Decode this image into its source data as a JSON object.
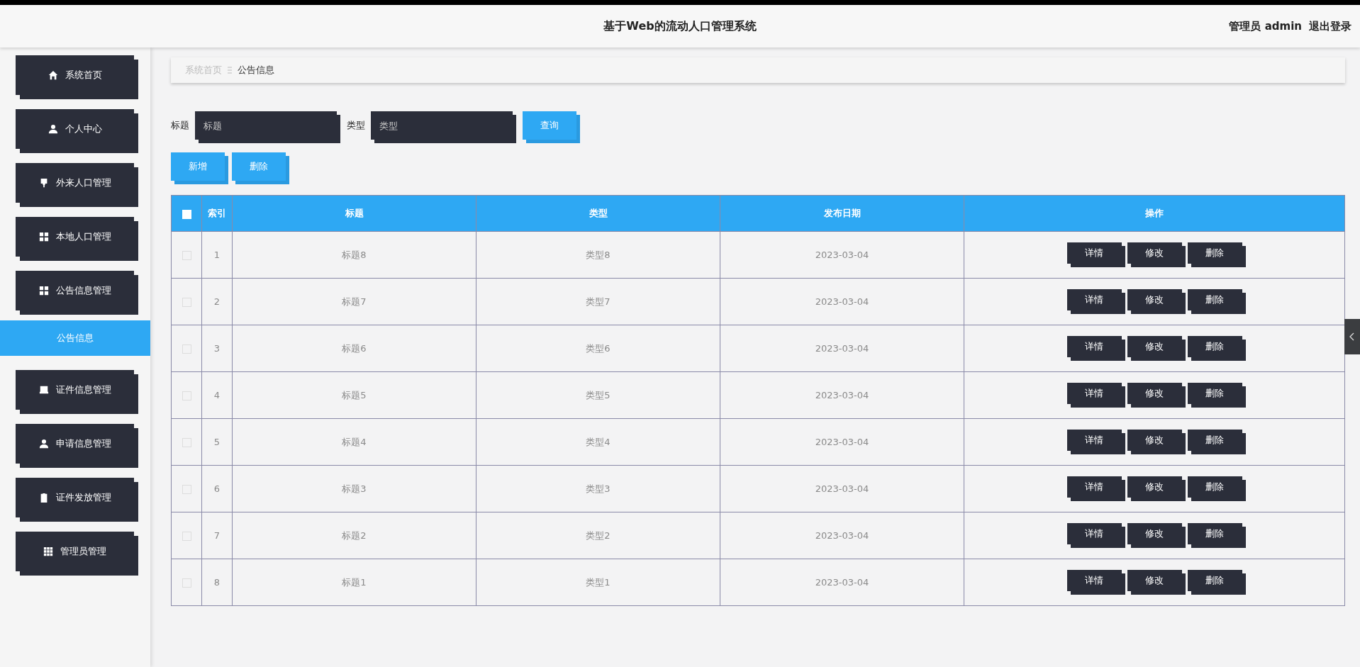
{
  "header": {
    "title": "基于Web的流动人口管理系统",
    "user": "管理员 admin",
    "logout": "退出登录"
  },
  "sidebar": {
    "items": [
      {
        "label": "系统首页"
      },
      {
        "label": "个人中心"
      },
      {
        "label": "外来人口管理"
      },
      {
        "label": "本地人口管理"
      },
      {
        "label": "公告信息管理",
        "children": [
          {
            "label": "公告信息",
            "selected": true
          }
        ]
      },
      {
        "label": "证件信息管理"
      },
      {
        "label": "申请信息管理"
      },
      {
        "label": "证件发放管理"
      },
      {
        "label": "管理员管理"
      }
    ]
  },
  "breadcrumb": [
    "系统首页",
    "公告信息"
  ],
  "search": {
    "fields": [
      {
        "label": "标题",
        "placeholder": "标题"
      },
      {
        "label": "类型",
        "placeholder": "类型"
      }
    ],
    "button": "查询"
  },
  "actions": [
    "新增",
    "删除"
  ],
  "table": {
    "select_all": {
      "checked": false
    },
    "columns": [
      "索引",
      "标题",
      "类型",
      "发布日期",
      "操作"
    ],
    "rows": [
      {
        "checked": false,
        "index": "1",
        "title": "标题8",
        "type": "类型8",
        "date": "2023-03-04",
        "buttons": [
          "详情",
          "修改",
          "删除"
        ]
      },
      {
        "checked": false,
        "index": "2",
        "title": "标题7",
        "type": "类型7",
        "date": "2023-03-04",
        "buttons": [
          "详情",
          "修改",
          "删除"
        ]
      },
      {
        "checked": false,
        "index": "3",
        "title": "标题6",
        "type": "类型6",
        "date": "2023-03-04",
        "buttons": [
          "详情",
          "修改",
          "删除"
        ]
      },
      {
        "checked": false,
        "index": "4",
        "title": "标题5",
        "type": "类型5",
        "date": "2023-03-04",
        "buttons": [
          "详情",
          "修改",
          "删除"
        ]
      },
      {
        "checked": false,
        "index": "5",
        "title": "标题4",
        "type": "类型4",
        "date": "2023-03-04",
        "buttons": [
          "详情",
          "修改",
          "删除"
        ]
      },
      {
        "checked": false,
        "index": "6",
        "title": "标题3",
        "type": "类型3",
        "date": "2023-03-04",
        "buttons": [
          "详情",
          "修改",
          "删除"
        ]
      },
      {
        "checked": false,
        "index": "7",
        "title": "标题2",
        "type": "类型2",
        "date": "2023-03-04",
        "buttons": [
          "详情",
          "修改",
          "删除"
        ]
      },
      {
        "checked": false,
        "index": "8",
        "title": "标题1",
        "type": "类型1",
        "date": "2023-03-04",
        "buttons": [
          "详情",
          "修改",
          "删除"
        ]
      }
    ]
  }
}
